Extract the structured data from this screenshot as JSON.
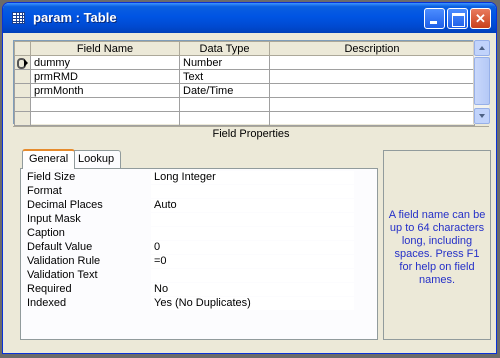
{
  "window": {
    "title": "param : Table"
  },
  "grid": {
    "headers": [
      "Field Name",
      "Data Type",
      "Description"
    ],
    "rows": [
      {
        "field": "dummy",
        "type": "Number",
        "desc": ""
      },
      {
        "field": "prmRMD",
        "type": "Text",
        "desc": ""
      },
      {
        "field": "prmMonth",
        "type": "Date/Time",
        "desc": ""
      }
    ]
  },
  "field_properties": {
    "title": "Field Properties",
    "tabs": [
      "General",
      "Lookup"
    ],
    "rows": [
      {
        "label": "Field Size",
        "value": "Long Integer"
      },
      {
        "label": "Format",
        "value": ""
      },
      {
        "label": "Decimal Places",
        "value": "Auto"
      },
      {
        "label": "Input Mask",
        "value": ""
      },
      {
        "label": "Caption",
        "value": ""
      },
      {
        "label": "Default Value",
        "value": "0"
      },
      {
        "label": "Validation Rule",
        "value": "=0"
      },
      {
        "label": "Validation Text",
        "value": ""
      },
      {
        "label": "Required",
        "value": "No"
      },
      {
        "label": "Indexed",
        "value": "Yes (No Duplicates)"
      }
    ]
  },
  "help": {
    "text": "A field name can be up to 64 characters long, including spaces. Press F1 for help on field names."
  },
  "colors": {
    "titlebar": "#0054e3",
    "help_text": "#2530c8",
    "tab_accent": "#e68b2c"
  }
}
